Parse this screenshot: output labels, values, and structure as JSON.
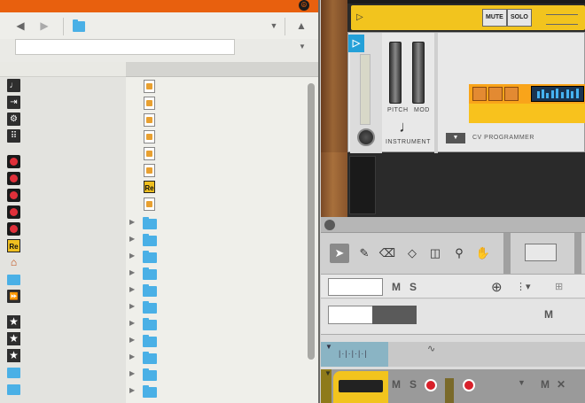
{
  "browser": {
    "nav": {
      "back": "◀",
      "forward": "▶",
      "up": "▲",
      "dropdown": "▼"
    },
    "search": {
      "value": "",
      "placeholder": ""
    },
    "left_items": [
      {
        "icon": "music-note-icon",
        "glyph": "♩"
      },
      {
        "icon": "route-icon",
        "glyph": "⇥"
      },
      {
        "icon": "share-nodes-icon",
        "glyph": "⚙"
      },
      {
        "icon": "grid-icon",
        "glyph": "⠿"
      },
      {
        "icon": "patch-red-icon",
        "glyph": ""
      },
      {
        "icon": "patch-red-icon",
        "glyph": ""
      },
      {
        "icon": "patch-red-icon",
        "glyph": ""
      },
      {
        "icon": "patch-red-icon",
        "glyph": ""
      },
      {
        "icon": "patch-red-icon",
        "glyph": ""
      },
      {
        "icon": "reason-file-icon",
        "glyph": "Re"
      },
      {
        "icon": "home-icon",
        "glyph": "⌂"
      },
      {
        "icon": "folder-icon",
        "glyph": ""
      },
      {
        "icon": "fast-forward-icon",
        "glyph": "⏩"
      },
      {
        "icon": "star-icon",
        "glyph": "★"
      },
      {
        "icon": "star-icon",
        "glyph": "★"
      },
      {
        "icon": "star-icon",
        "glyph": "★"
      },
      {
        "icon": "folder-icon",
        "glyph": ""
      },
      {
        "icon": "folder-icon",
        "glyph": ""
      }
    ],
    "right_items": [
      {
        "type": "file",
        "icon": "patch-file-icon"
      },
      {
        "type": "file",
        "icon": "patch-file-icon"
      },
      {
        "type": "file",
        "icon": "patch-file-icon"
      },
      {
        "type": "file",
        "icon": "patch-file-icon"
      },
      {
        "type": "file",
        "icon": "patch-file-icon"
      },
      {
        "type": "file",
        "icon": "patch-file-icon"
      },
      {
        "type": "file",
        "icon": "reason-file-icon",
        "glyph": "Re"
      },
      {
        "type": "file",
        "icon": "patch-file-icon"
      },
      {
        "type": "folder",
        "icon": "folder-icon"
      },
      {
        "type": "folder",
        "icon": "folder-icon"
      },
      {
        "type": "folder",
        "icon": "folder-icon"
      },
      {
        "type": "folder",
        "icon": "folder-icon"
      },
      {
        "type": "folder",
        "icon": "folder-icon"
      },
      {
        "type": "folder",
        "icon": "folder-icon"
      },
      {
        "type": "folder",
        "icon": "folder-icon"
      },
      {
        "type": "folder",
        "icon": "folder-icon"
      },
      {
        "type": "folder",
        "icon": "folder-icon"
      },
      {
        "type": "folder",
        "icon": "folder-icon"
      },
      {
        "type": "folder",
        "icon": "folder-icon"
      }
    ]
  },
  "rack": {
    "mute": "MUTE",
    "solo": "SOLO",
    "pitch": "PITCH",
    "mod": "MOD",
    "instrument": "INSTRUMENT",
    "cv_programmer": "CV PROGRAMMER"
  },
  "sequencer": {
    "track1": {
      "m": "M",
      "s": "S"
    },
    "track2": {
      "m": "M"
    },
    "track3": {
      "m": "M",
      "s": "S",
      "m2": "M",
      "close": "✕"
    }
  },
  "colors": {
    "accent": "#e8600e",
    "device_yellow": "#f2c41e",
    "sequencer_orange": "#f9a41a",
    "folder_blue": "#4ab0e6",
    "record_red": "#d8202a"
  }
}
